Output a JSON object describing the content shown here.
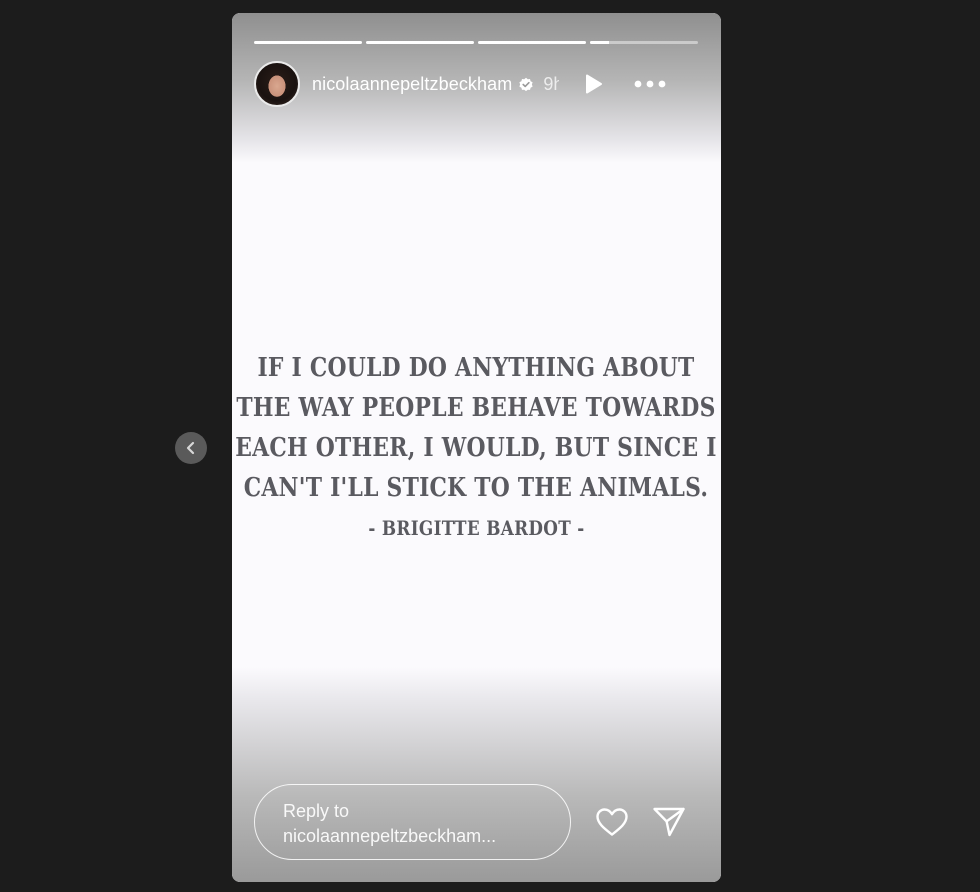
{
  "story": {
    "progress": [
      1,
      1,
      1,
      0.18
    ],
    "header": {
      "username": "nicolaannepeltzbeckham",
      "verified": true,
      "time_ago": "9h",
      "icons": [
        "avatar",
        "verified-badge-icon",
        "play-icon",
        "more-icon"
      ]
    },
    "quote": {
      "text": "If I could do anything about the way people behave towards each other, I would, but since I can't I'll stick to the animals.",
      "author": "- Brigitte Bardot -"
    },
    "footer": {
      "reply_placeholder_line1": "Reply to",
      "reply_placeholder_line2": "nicolaannepeltzbeckham...",
      "icons": [
        "heart-icon",
        "send-icon"
      ]
    }
  },
  "navigation": {
    "prev_icon": "chevron-left-icon"
  },
  "colors": {
    "background": "#1c1c1c",
    "card": "#fbfafd",
    "quote_text": "#5a5a60"
  }
}
